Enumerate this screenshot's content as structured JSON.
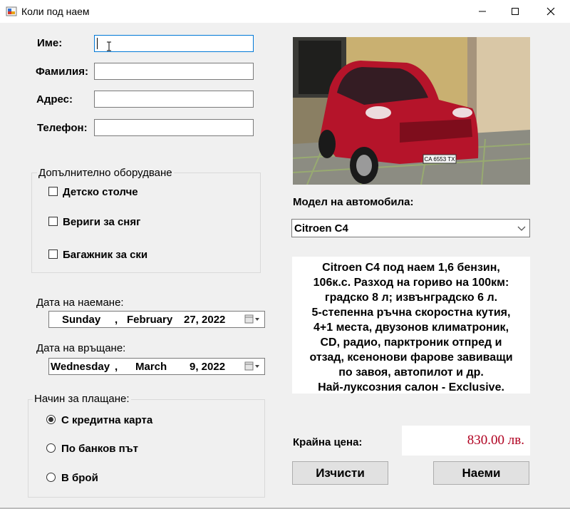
{
  "window": {
    "title": "Коли под наем"
  },
  "form": {
    "first_name_label": "Име:",
    "last_name_label": "Фамилия:",
    "address_label": "Адрес:",
    "phone_label": "Телефон:",
    "first_name_value": "",
    "last_name_value": "",
    "address_value": "",
    "phone_value": ""
  },
  "extras": {
    "title": "Допълнително оборудване",
    "items": [
      {
        "label": "Детско столче",
        "checked": false
      },
      {
        "label": "Вериги за сняг",
        "checked": false
      },
      {
        "label": "Багажник за ски",
        "checked": false
      }
    ]
  },
  "rental_date": {
    "label": "Дата на наемане:",
    "weekday": "Sunday",
    "sep": ",",
    "month": "February",
    "day_year": "27, 2022"
  },
  "return_date": {
    "label": "Дата на връщане:",
    "weekday": "Wednesday",
    "sep": ",",
    "month": "March",
    "day_year": "9, 2022"
  },
  "payment": {
    "title": "Начин за плащане:",
    "options": [
      {
        "label": "С кредитна карта",
        "selected": true
      },
      {
        "label": "По банков път",
        "selected": false
      },
      {
        "label": "В брой",
        "selected": false
      }
    ]
  },
  "car": {
    "plate": "CA 6553 TX",
    "model_label": "Модел на автомобила:",
    "model_selected": "Citroen C4",
    "description_lines": [
      "Citroen C4 под наем 1,6 бензин,",
      "106к.с. Разход на гориво на 100км:",
      "градско 8 л; извънградско 6 л.",
      "5-степенна ръчна скоростна кутия,",
      "4+1 места, двузонов климатроник,",
      "CD, радио, парктроник отпред и",
      "отзад, ксенонови фарове завиващи",
      "по завоя, автопилот и др.",
      "Най-луксозния салон - Exclusive."
    ],
    "body_color": "#b5142a"
  },
  "price": {
    "label": "Крайна цена:",
    "value": "830.00 лв."
  },
  "buttons": {
    "clear": "Изчисти",
    "rent": "Наеми"
  }
}
